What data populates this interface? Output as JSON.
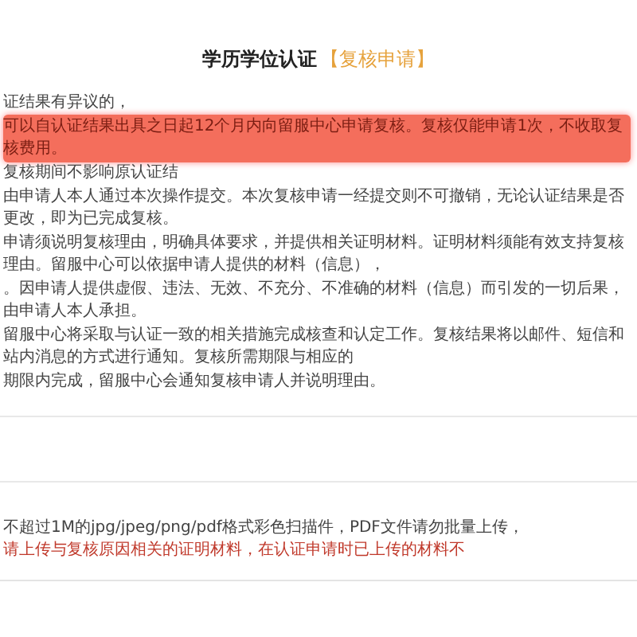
{
  "title": {
    "main": "学历学位认证",
    "tag": "【复核申请】"
  },
  "notice": [
    [
      {
        "kind": "plain",
        "text": "证结果有异议的，"
      },
      {
        "kind": "highlight",
        "text": "可以自认证结果出具之日起12个月内向留服中心申请复核。复核仅能申请1次，不收取复核费用。"
      },
      {
        "kind": "plain",
        "text": "复核期间不影响原认证结"
      }
    ],
    [
      {
        "kind": "plain",
        "text": "由申请人本人通过本次操作提交。本次复核申请一经提交则不可撤销，无论认证结果是否更改，即为已完成复核。"
      }
    ],
    [
      {
        "kind": "plain",
        "text": "申请须说明复核理由，明确具体要求，并提供相关证明材料。证明材料须能有效支持复核理由。留服中心可以依据申请人提供的材料（信息），"
      }
    ],
    [
      {
        "kind": "plain",
        "text": "。因申请人提供虚假、违法、无效、不充分、不准确的材料（信息）而引发的一切后果，由申请人本人承担。"
      }
    ],
    [
      {
        "kind": "plain",
        "text": "留服中心将采取与认证一致的相关措施完成核查和认定工作。复核结果将以邮件、短信和站内消息的方式进行通知。复核所需期限与相应的"
      }
    ],
    [
      {
        "kind": "plain",
        "text": "期限内完成，留服中心会通知复核申请人并说明理由。"
      }
    ]
  ],
  "upload_hint": [
    {
      "kind": "plain",
      "text": "不超过1M的jpg/jpeg/png/pdf格式彩色扫描件，PDF文件请勿批量上传，"
    },
    {
      "kind": "warning",
      "text": "请上传与复核原因相关的证明材料，在认证申请时已上传的材料不"
    }
  ]
}
